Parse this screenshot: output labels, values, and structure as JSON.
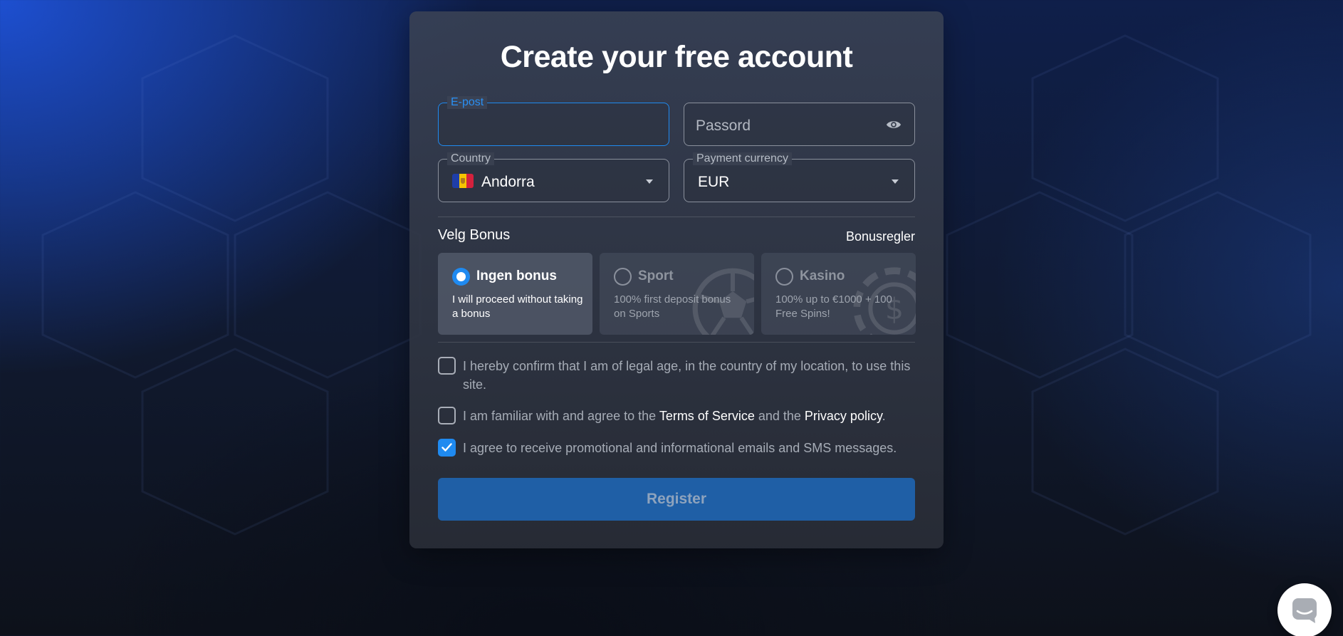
{
  "form": {
    "title": "Create your free account",
    "email": {
      "label": "E-post",
      "value": ""
    },
    "password": {
      "placeholder": "Passord",
      "icon": "eye-icon"
    },
    "country": {
      "label": "Country",
      "value": "Andorra",
      "flag_colors": [
        "#1e3ea8",
        "#f5c400",
        "#d4213d"
      ]
    },
    "currency": {
      "label": "Payment currency",
      "value": "EUR"
    }
  },
  "bonus": {
    "heading": "Velg Bonus",
    "rules_link": "Bonusregler",
    "selected": "none",
    "options": [
      {
        "title": "Ingen bonus",
        "description": "I will proceed without taking a bonus",
        "selected": true
      },
      {
        "title": "Sport",
        "description": "100% first deposit bonus on Sports",
        "selected": false,
        "icon": "soccer-ball-icon"
      },
      {
        "title": "Kasino",
        "description": "100% up to €1000 + 100 Free Spins!",
        "selected": false,
        "icon": "casino-chip-icon"
      }
    ]
  },
  "consents": {
    "legal_age": {
      "text": "I hereby confirm that I am of legal age, in the country of my location, to use this site.",
      "checked": false
    },
    "terms": {
      "prefix": "I am familiar with and agree to the ",
      "terms_link": "Terms of Service",
      "middle": " and the ",
      "privacy_link": "Privacy policy",
      "suffix": ".",
      "checked": false
    },
    "marketing": {
      "text": "I agree to receive promotional and informational emails and SMS messages.",
      "checked": true
    }
  },
  "register_label": "Register",
  "colors": {
    "accent": "#1f8af0",
    "button": "#1f5fa6",
    "card": "#2d323d"
  },
  "chat_widget": {
    "icon": "chat-bubble-icon"
  }
}
